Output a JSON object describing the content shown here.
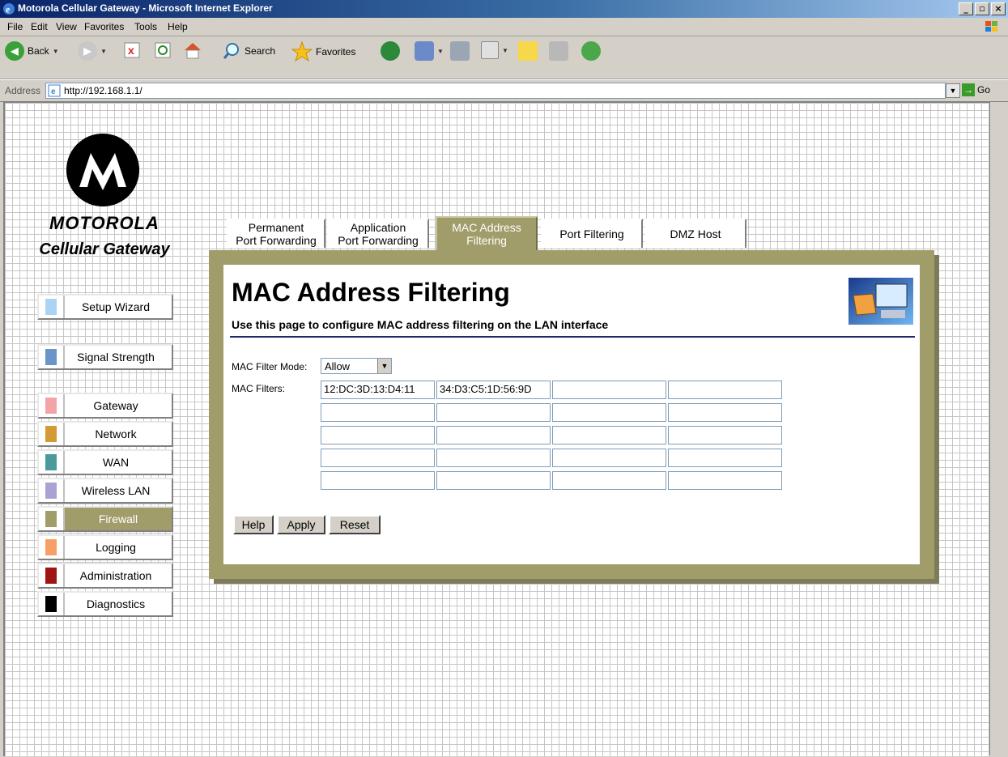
{
  "window": {
    "title": "Motorola Cellular Gateway - Microsoft Internet Explorer",
    "min": "_",
    "max": "▫",
    "close": "×"
  },
  "menu": [
    "File",
    "Edit",
    "View",
    "Favorites",
    "Tools",
    "Help"
  ],
  "toolbar": {
    "back": "Back",
    "search": "Search",
    "favorites": "Favorites"
  },
  "address": {
    "label": "Address",
    "url": "http://192.168.1.1/",
    "go": "Go"
  },
  "brand": {
    "name": "MOTOROLA",
    "product": "Cellular Gateway"
  },
  "nav_top": [
    {
      "label": "Setup Wizard",
      "color": "#aad4f5"
    },
    {
      "label": "Signal Strength",
      "color": "#6a95c8"
    }
  ],
  "nav_main": [
    {
      "label": "Gateway",
      "color": "#f4a3a8"
    },
    {
      "label": "Network",
      "color": "#d39a35"
    },
    {
      "label": "WAN",
      "color": "#4a9a9a"
    },
    {
      "label": "Wireless LAN",
      "color": "#a9a3d4"
    },
    {
      "label": "Firewall",
      "color": "#a19d6b",
      "active": true
    },
    {
      "label": "Logging",
      "color": "#f7a066"
    },
    {
      "label": "Administration",
      "color": "#a01414"
    },
    {
      "label": "Diagnostics",
      "color": "#000000"
    }
  ],
  "tabs": [
    {
      "line1": "Permanent",
      "line2": "Port Forwarding"
    },
    {
      "line1": "Application",
      "line2": "Port Forwarding"
    },
    {
      "line1": "MAC Address",
      "line2": "Filtering",
      "active": true
    },
    {
      "line1": "Port Filtering",
      "line2": ""
    },
    {
      "line1": "DMZ Host",
      "line2": ""
    }
  ],
  "page": {
    "title": "MAC Address Filtering",
    "subtitle": "Use this page to configure MAC address filtering on the LAN interface",
    "mode_label": "MAC Filter Mode:",
    "mode_value": "Allow",
    "filters_label": "MAC Filters:",
    "filters": [
      "12:DC:3D:13:D4:11",
      "34:D3:C5:1D:56:9D",
      "",
      "",
      "",
      "",
      "",
      "",
      "",
      "",
      "",
      "",
      "",
      "",
      "",
      "",
      "",
      "",
      "",
      ""
    ],
    "buttons": {
      "help": "Help",
      "apply": "Apply",
      "reset": "Reset"
    }
  },
  "colors": {
    "accent": "#a19d6b",
    "rule": "#1f2a6a"
  }
}
